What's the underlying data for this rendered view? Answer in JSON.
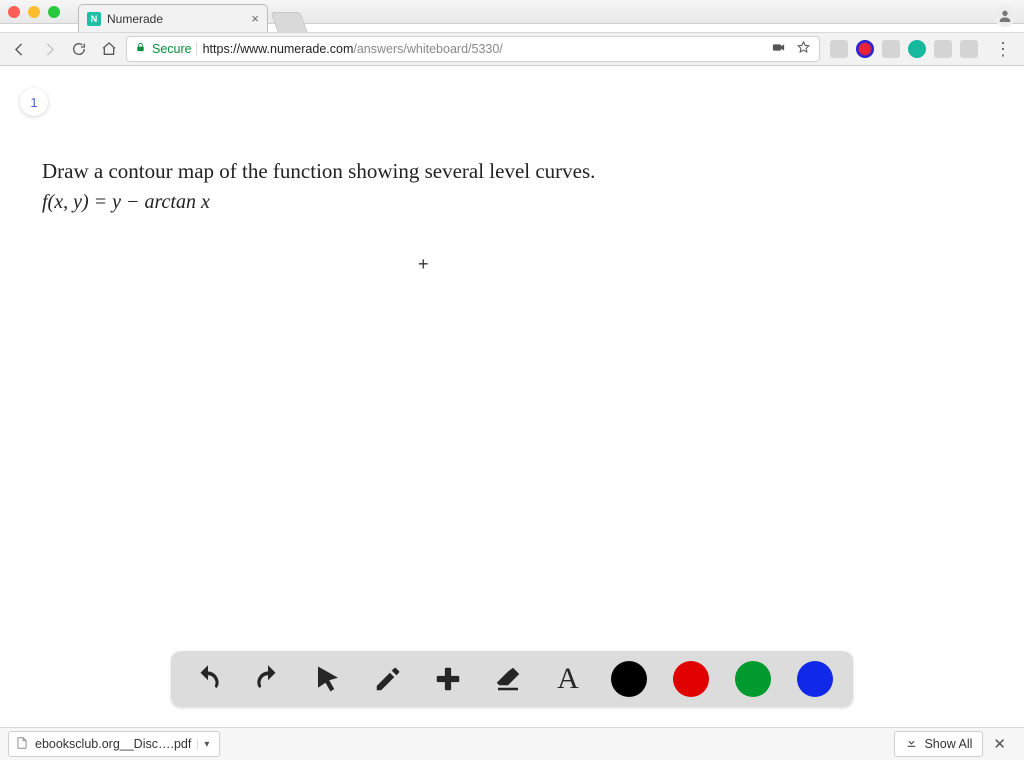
{
  "window": {
    "tab_title": "Numerade",
    "favicon_letter": "N"
  },
  "toolbar": {
    "secure_label": "Secure",
    "url_scheme_host": "https://www.numerade.com",
    "url_path": "/answers/whiteboard/5330/"
  },
  "page": {
    "slide_number": "1",
    "question_text": "Draw a contour map of the function showing several level curves.",
    "equation_text": "f(x, y) = y − arctan x"
  },
  "whiteboard_toolbar": {
    "undo": "undo",
    "redo": "redo",
    "select": "select",
    "pencil": "pencil",
    "add": "add",
    "eraser": "eraser",
    "text": "A",
    "colors": [
      "black",
      "red",
      "green",
      "blue"
    ]
  },
  "downloads": {
    "file_label": "ebooksclub.org__Disc….pdf",
    "show_all_label": "Show All"
  }
}
